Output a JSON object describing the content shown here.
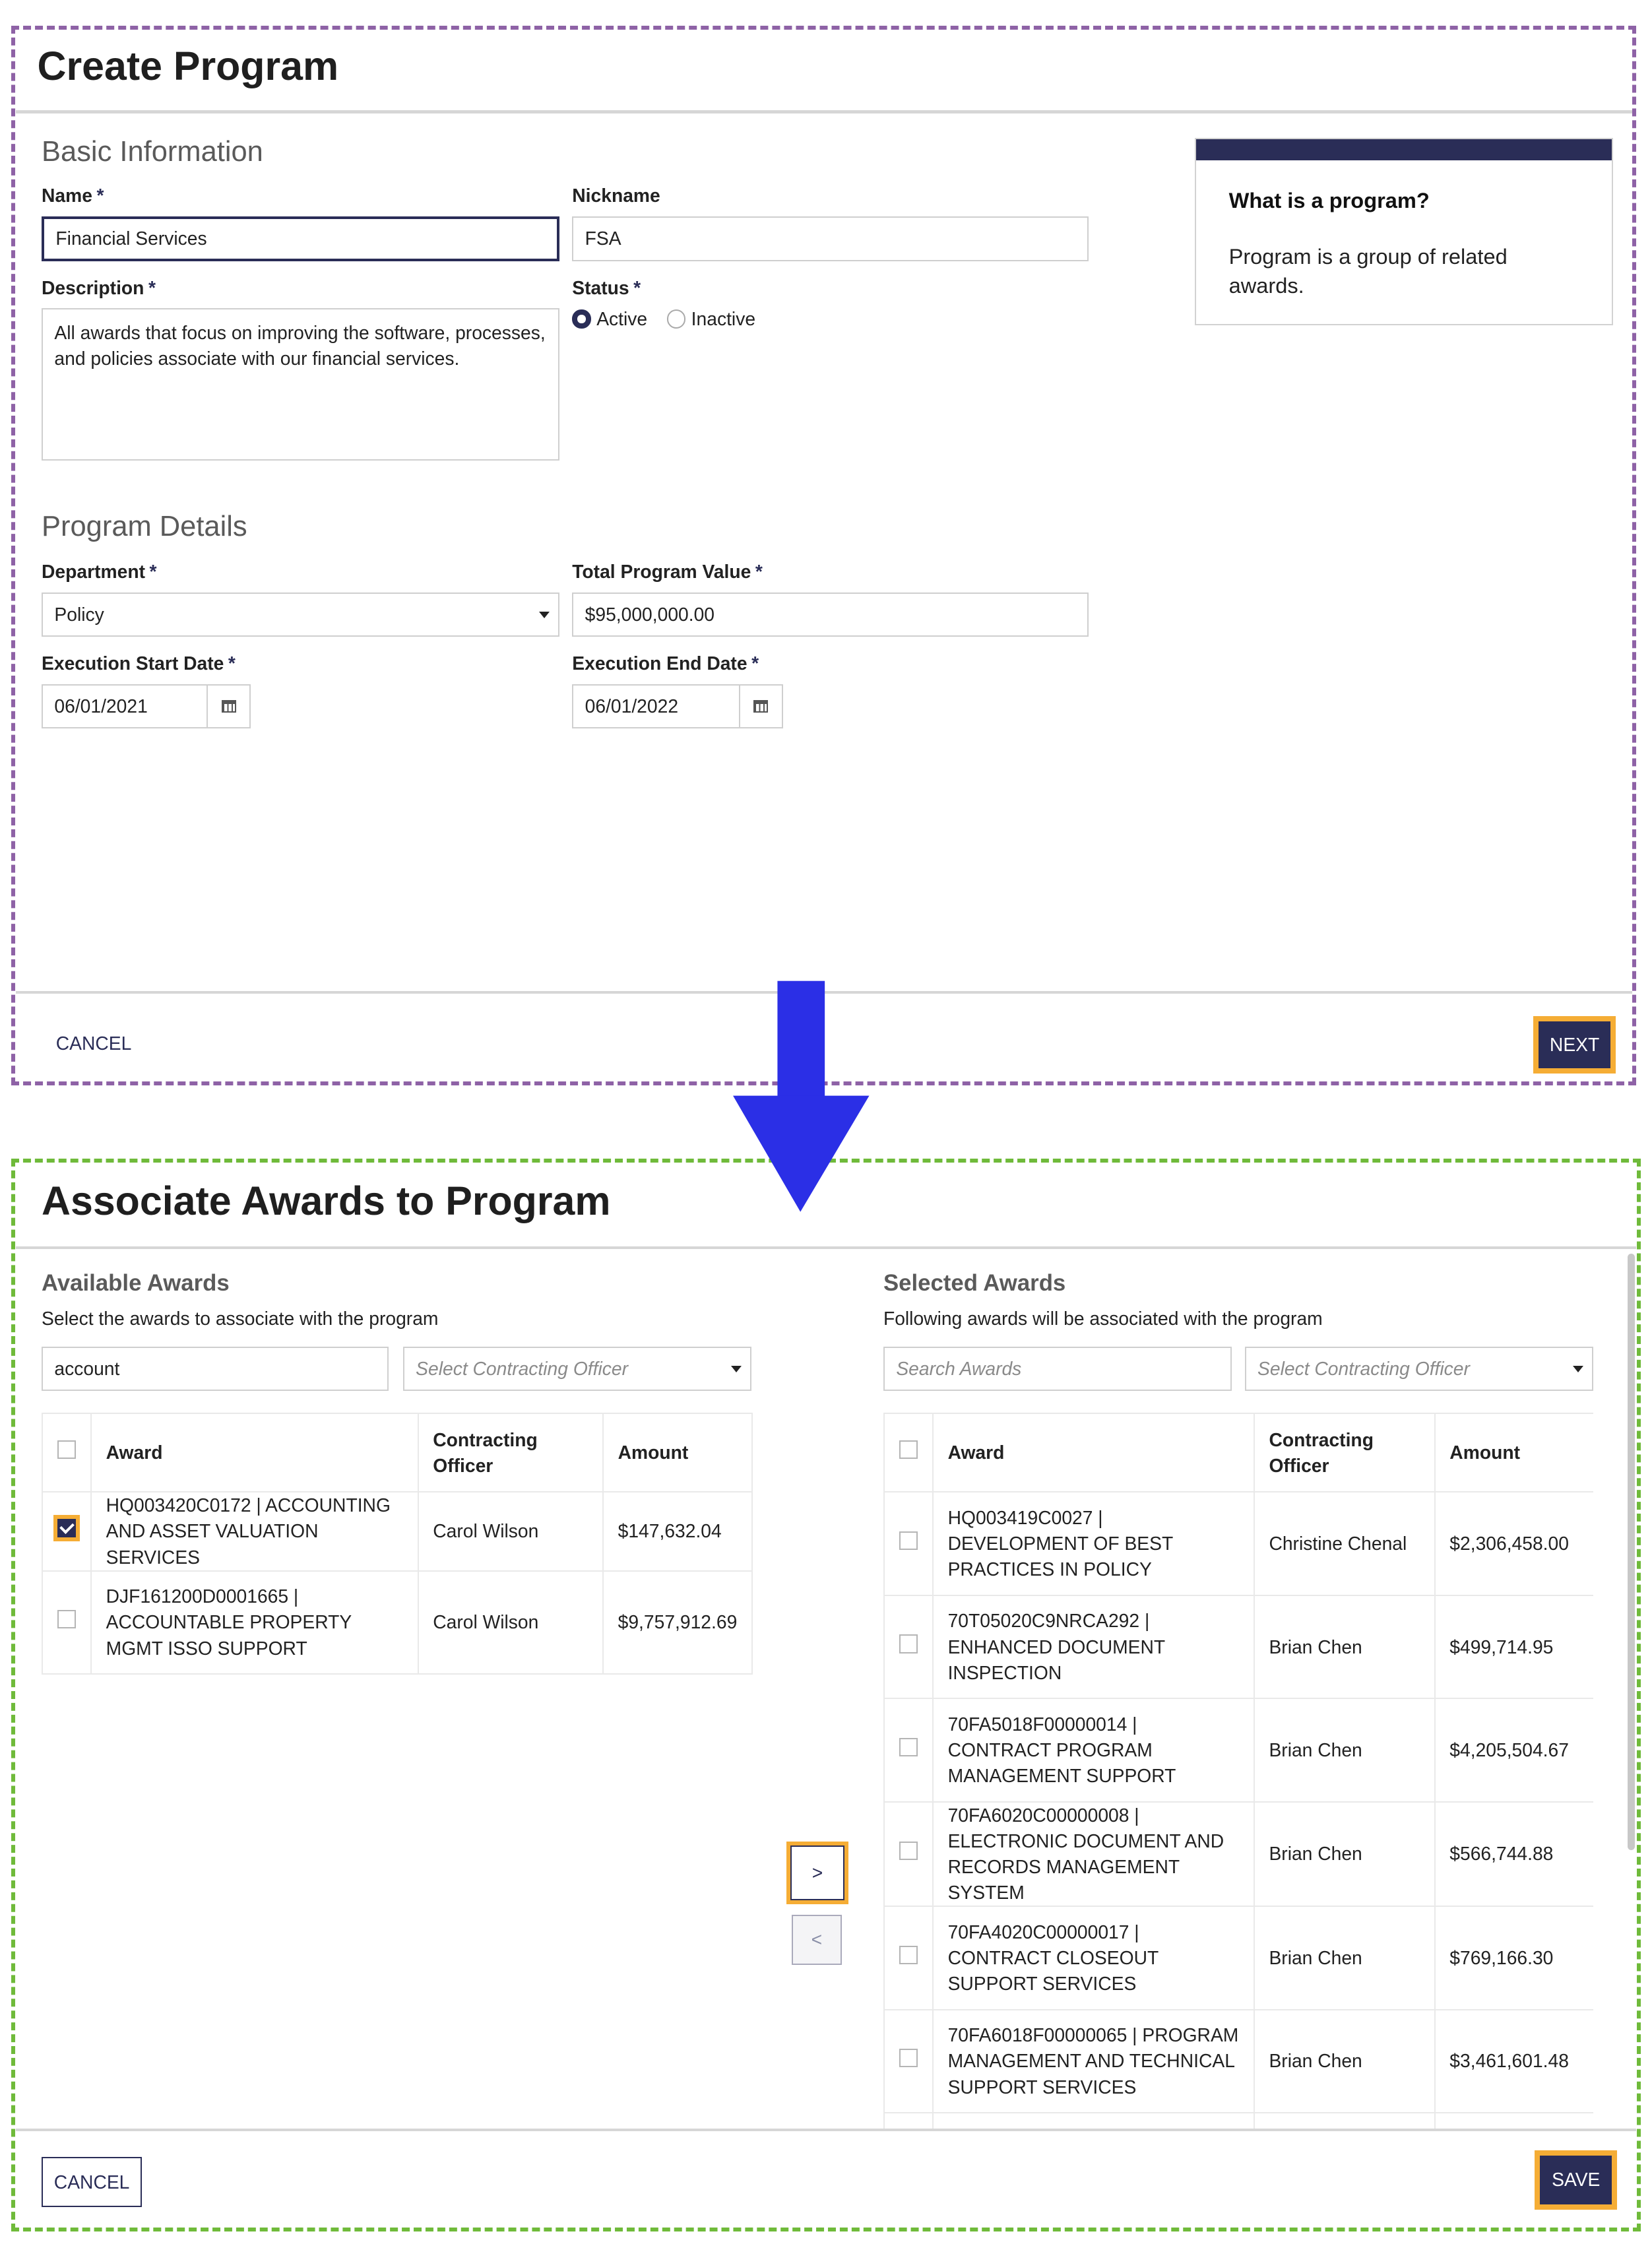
{
  "create": {
    "title": "Create Program",
    "basic_section": "Basic Information",
    "name_label": "Name",
    "name_value": "Financial Services",
    "nickname_label": "Nickname",
    "nickname_value": "FSA",
    "description_label": "Description",
    "description_value": "All awards that focus on improving the software, processes, and policies associate with our financial services.",
    "status_label": "Status",
    "status_options": [
      "Active",
      "Inactive"
    ],
    "status_selected": "Active",
    "details_section": "Program Details",
    "department_label": "Department",
    "department_value": "Policy",
    "total_label": "Total Program Value",
    "total_value": "$95,000,000.00",
    "start_label": "Execution Start Date",
    "start_value": "06/01/2021",
    "end_label": "Execution End Date",
    "end_value": "06/01/2022",
    "required_mark": "*",
    "info_title": "What is a program?",
    "info_text": "Program is a group of related awards.",
    "cancel_label": "CANCEL",
    "next_label": "NEXT"
  },
  "associate": {
    "title": "Associate Awards to Program",
    "available": {
      "heading": "Available Awards",
      "subtitle": "Select the awards to associate with the program",
      "search_value": "account",
      "officer_placeholder": "Select Contracting Officer",
      "columns": [
        "Award",
        "Contracting Officer",
        "Amount"
      ],
      "rows": [
        {
          "award": "HQ003420C0172 | ACCOUNTING AND ASSET VALUATION SERVICES",
          "officer": "Carol Wilson",
          "amount": "$147,632.04",
          "checked": true
        },
        {
          "award": "DJF161200D0001665 | ACCOUNTABLE PROPERTY MGMT ISSO SUPPORT",
          "officer": "Carol Wilson",
          "amount": "$9,757,912.69",
          "checked": false
        }
      ]
    },
    "selected": {
      "heading": "Selected Awards",
      "subtitle": "Following awards will be associated with the program",
      "search_placeholder": "Search Awards",
      "officer_placeholder": "Select Contracting Officer",
      "columns": [
        "Award",
        "Contracting Officer",
        "Amount"
      ],
      "rows": [
        {
          "award": "HQ003419C0027 | DEVELOPMENT OF BEST PRACTICES IN POLICY",
          "officer": "Christine Chenal",
          "amount": "$2,306,458.00",
          "checked": false
        },
        {
          "award": "70T05020C9NRCA292 | ENHANCED DOCUMENT INSPECTION",
          "officer": "Brian Chen",
          "amount": "$499,714.95",
          "checked": false
        },
        {
          "award": "70FA5018F00000014 | CONTRACT PROGRAM MANAGEMENT SUPPORT",
          "officer": "Brian Chen",
          "amount": "$4,205,504.67",
          "checked": false
        },
        {
          "award": "70FA6020C00000008 | ELECTRONIC DOCUMENT AND RECORDS MANAGEMENT SYSTEM",
          "officer": "Brian Chen",
          "amount": "$566,744.88",
          "checked": false
        },
        {
          "award": "70FA4020C00000017 | CONTRACT CLOSEOUT SUPPORT SERVICES",
          "officer": "Brian Chen",
          "amount": "$769,166.30",
          "checked": false
        },
        {
          "award": "70FA6018F00000065 | PROGRAM MANAGEMENT AND TECHNICAL SUPPORT SERVICES",
          "officer": "Brian Chen",
          "amount": "$3,461,601.48",
          "checked": false
        }
      ]
    },
    "move_right_label": ">",
    "move_left_label": "<",
    "cancel_label": "CANCEL",
    "save_label": "SAVE"
  },
  "colors": {
    "primary": "#2a2d57",
    "highlight": "#f5ad35",
    "step1_frame": "#8e62a6",
    "step2_frame": "#6fba3a",
    "arrow": "#2b2fe6"
  },
  "icons": {
    "calendar": "calendar-icon",
    "dropdown": "caret-down-icon",
    "flow_arrow": "arrow-down-icon"
  }
}
